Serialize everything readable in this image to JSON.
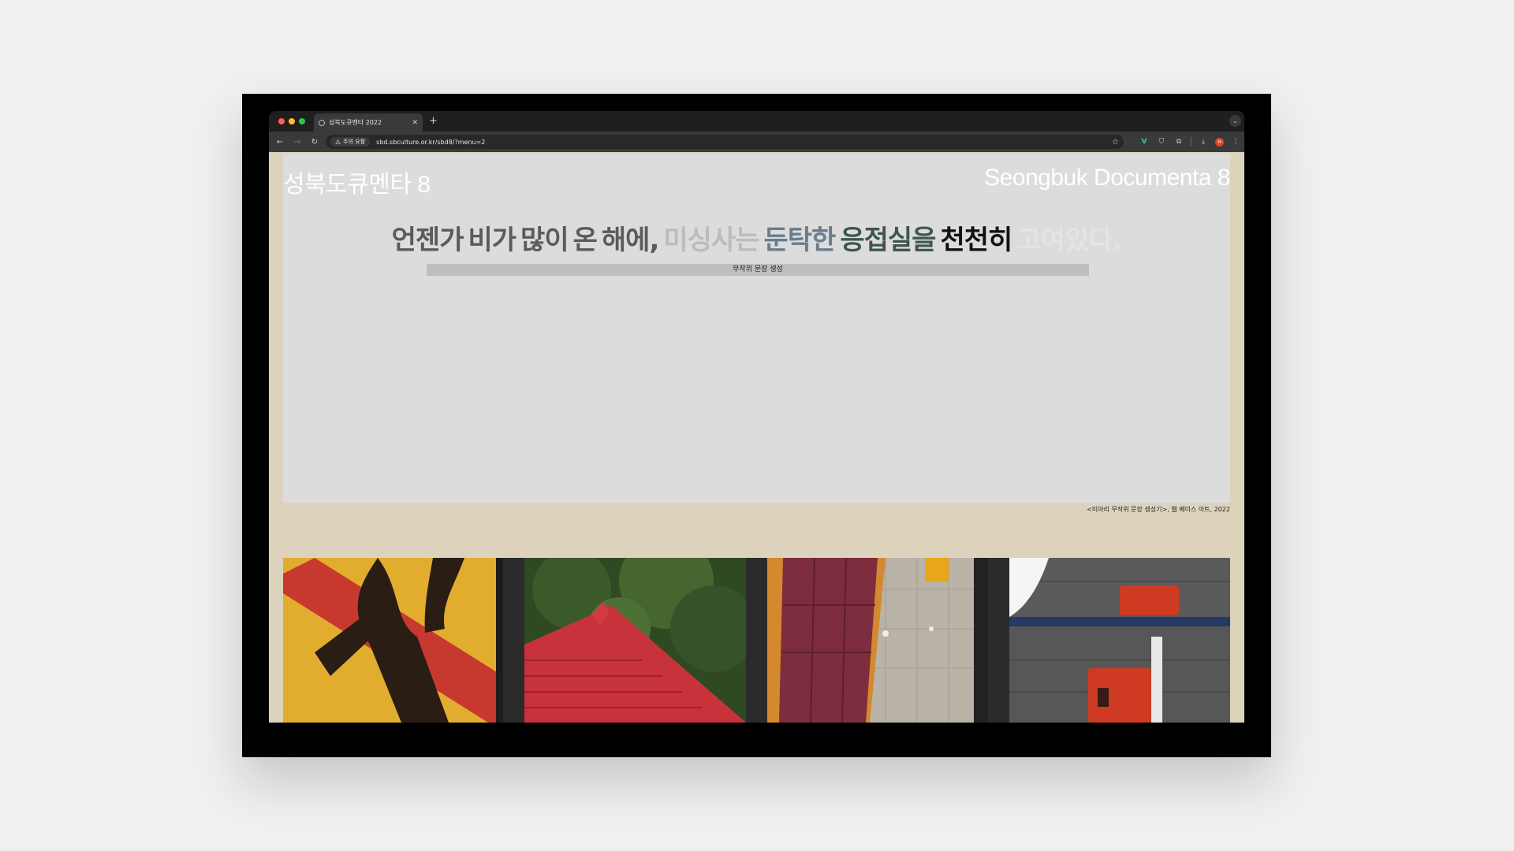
{
  "browser": {
    "tab": {
      "title": "성북도큐멘타 2022"
    },
    "toolbar": {
      "security_label": "주의 요함",
      "url": "sbd.sbculture.or.kr/sbd8/?menu=2"
    }
  },
  "page": {
    "title_ko": "성북도큐멘타 8",
    "title_en": "Seongbuk Documenta 8",
    "sentence": [
      {
        "text": "언젠가",
        "color": "#5b5b5b"
      },
      {
        "text": "비가",
        "color": "#5b5b5b"
      },
      {
        "text": "많이",
        "color": "#5b5b5b"
      },
      {
        "text": "온",
        "color": "#5b5b5b"
      },
      {
        "text": "해에,",
        "color": "#5b5b5b"
      },
      {
        "text": "미싱사는",
        "color": "#bcbcbc"
      },
      {
        "text": "둔탁한",
        "color": "#6b7d8c"
      },
      {
        "text": "응접실을",
        "color": "#3f5551"
      },
      {
        "text": "천천히",
        "color": "#111111"
      },
      {
        "text": "고여있다.",
        "color": "#e4e4e4"
      }
    ],
    "generate_button": "무작위 문장 생성",
    "caption": "<미아리 무작위 문장 생성기>, 웹 베이스 아트, 2022"
  }
}
